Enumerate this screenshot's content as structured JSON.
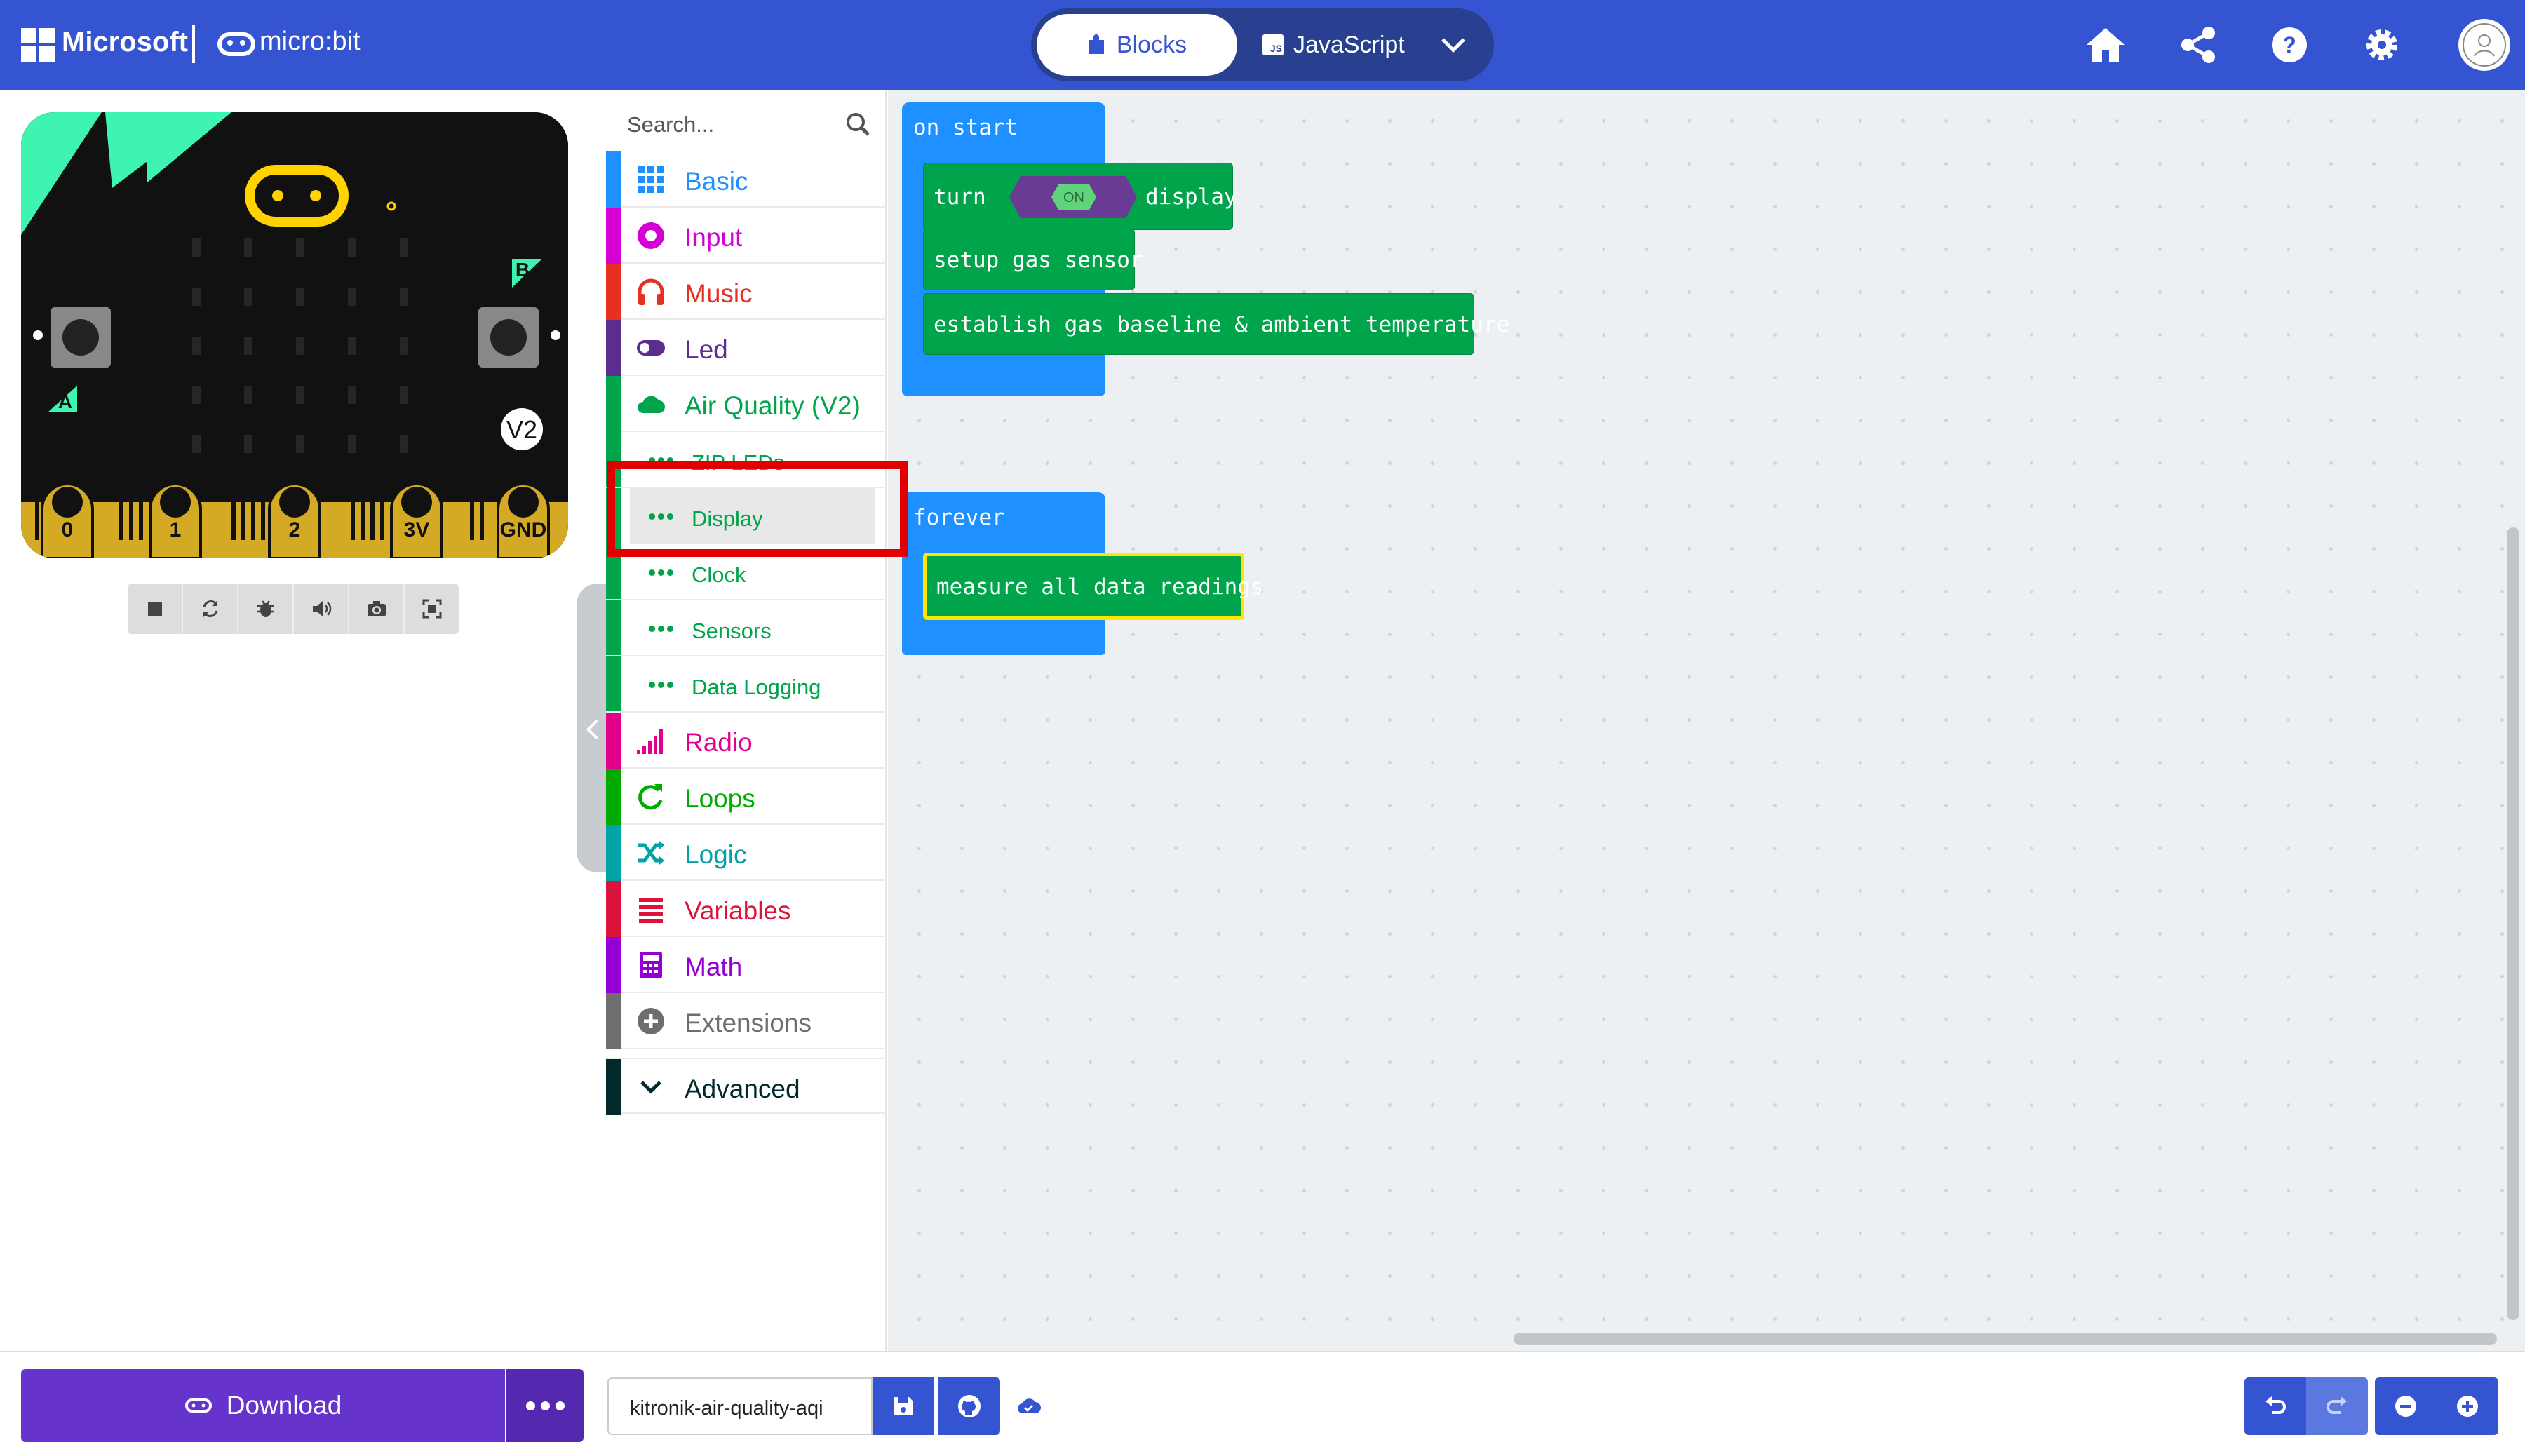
{
  "header": {
    "brand": "Microsoft",
    "product": "micro:bit",
    "tabs": [
      {
        "label": "Blocks",
        "icon": "puzzle-icon"
      },
      {
        "label": "JavaScript",
        "icon": "js-icon"
      }
    ],
    "right_icons": [
      "home-icon",
      "share-icon",
      "help-icon",
      "gear-icon",
      "avatar"
    ],
    "accent": "#3454d1"
  },
  "simulator": {
    "version_badge": "V2",
    "button_a": "A",
    "button_b": "B",
    "pins": [
      "0",
      "1",
      "2",
      "3V",
      "GND"
    ],
    "controls": [
      "stop-icon",
      "restart-icon",
      "debug-icon",
      "sound-icon",
      "screenshot-icon",
      "fullscreen-icon"
    ]
  },
  "toolbox": {
    "search_placeholder": "Search...",
    "categories": [
      {
        "label": "Basic",
        "color": "#1e90ff",
        "icon": "grid-icon"
      },
      {
        "label": "Input",
        "color": "#d400d4",
        "icon": "circle-dot-icon"
      },
      {
        "label": "Music",
        "color": "#e63022",
        "icon": "headphones-icon"
      },
      {
        "label": "Led",
        "color": "#5c2d91",
        "icon": "toggle-icon"
      },
      {
        "label": "Air Quality (V2)",
        "color": "#00a44a",
        "icon": "cloud-icon"
      },
      {
        "label": "ZIP LEDs",
        "color": "#00a44a",
        "icon": "dots-icon"
      },
      {
        "label": "Display",
        "color": "#00a44a",
        "icon": "dots-icon"
      },
      {
        "label": "Clock",
        "color": "#00a44a",
        "icon": "dots-icon"
      },
      {
        "label": "Sensors",
        "color": "#00a44a",
        "icon": "dots-icon"
      },
      {
        "label": "Data Logging",
        "color": "#00a44a",
        "icon": "dots-icon"
      },
      {
        "label": "Radio",
        "color": "#e3008c",
        "icon": "signal-icon"
      },
      {
        "label": "Loops",
        "color": "#00aa00",
        "icon": "loop-icon"
      },
      {
        "label": "Logic",
        "color": "#00a4a6",
        "icon": "shuffle-icon"
      },
      {
        "label": "Variables",
        "color": "#dc143c",
        "icon": "list-icon"
      },
      {
        "label": "Math",
        "color": "#9400d3",
        "icon": "calculator-icon"
      },
      {
        "label": "Extensions",
        "color": "#6e6e6e",
        "icon": "plus-circle-icon"
      },
      {
        "label": "Advanced",
        "color": "#002a2c",
        "icon": "chevron-down-icon"
      }
    ]
  },
  "workspace": {
    "on_start": {
      "label": "on start",
      "turn": "turn",
      "toggle": "ON",
      "display": "display",
      "setup": "setup gas sensor",
      "baseline": "establish gas baseline & ambient temperature"
    },
    "forever": {
      "label": "forever",
      "measure": "measure all data readings"
    }
  },
  "footer": {
    "download": "Download",
    "project_name": "kitronik-air-quality-aqi"
  }
}
